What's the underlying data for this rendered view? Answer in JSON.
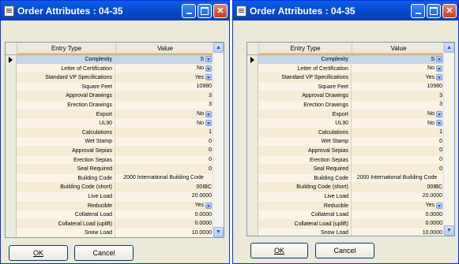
{
  "windows": [
    {
      "title": "Order Attributes : 04-35",
      "columns": {
        "entry_type": "Entry Type",
        "value": "Value"
      },
      "ok_label": "OK",
      "cancel_label": "Cancel"
    },
    {
      "title": "Order Attributes : 04-35",
      "columns": {
        "entry_type": "Entry Type",
        "value": "Value"
      },
      "ok_label": "OK",
      "cancel_label": "Cancel"
    }
  ],
  "rows": [
    {
      "name": "Complexity",
      "value": "S",
      "dropdown": true
    },
    {
      "name": "Letter of Certification",
      "value": "No",
      "dropdown": true
    },
    {
      "name": "Standard VP Specifications",
      "value": "Yes",
      "dropdown": true
    },
    {
      "name": "Square Feet",
      "value": "10980",
      "dropdown": false
    },
    {
      "name": "Approval Drawings",
      "value": "3",
      "dropdown": false
    },
    {
      "name": "Erection Drawings",
      "value": "3",
      "dropdown": false
    },
    {
      "name": "Export",
      "value": "No",
      "dropdown": true
    },
    {
      "name": "UL90",
      "value": "No",
      "dropdown": true
    },
    {
      "name": "Calculations",
      "value": "1",
      "dropdown": false
    },
    {
      "name": "Wet Stamp",
      "value": "0",
      "dropdown": false
    },
    {
      "name": "Approval Sepias",
      "value": "0",
      "dropdown": false
    },
    {
      "name": "Erection Sepias",
      "value": "0",
      "dropdown": false
    },
    {
      "name": "Seal Required",
      "value": "0",
      "dropdown": false
    },
    {
      "name": "Building Code",
      "value": "2000 International Building Code",
      "dropdown": false,
      "center": true
    },
    {
      "name": "Building Code (short)",
      "value": "00IBC",
      "dropdown": false
    },
    {
      "name": "Live Load",
      "value": "20.0000",
      "dropdown": false
    },
    {
      "name": "Reducible",
      "value": "Yes",
      "dropdown": true
    },
    {
      "name": "Collateral Load",
      "value": "0.0000",
      "dropdown": false
    },
    {
      "name": "Collateral Load (uplift)",
      "value": "0.0000",
      "dropdown": false
    },
    {
      "name": "Snow Load",
      "value": "10.0000",
      "dropdown": false
    }
  ],
  "icons": {
    "app": "document-icon",
    "minimize": "minimize-icon",
    "maximize": "maximize-icon",
    "close": "close-icon",
    "row_selector": "row-selector-arrow-icon"
  }
}
